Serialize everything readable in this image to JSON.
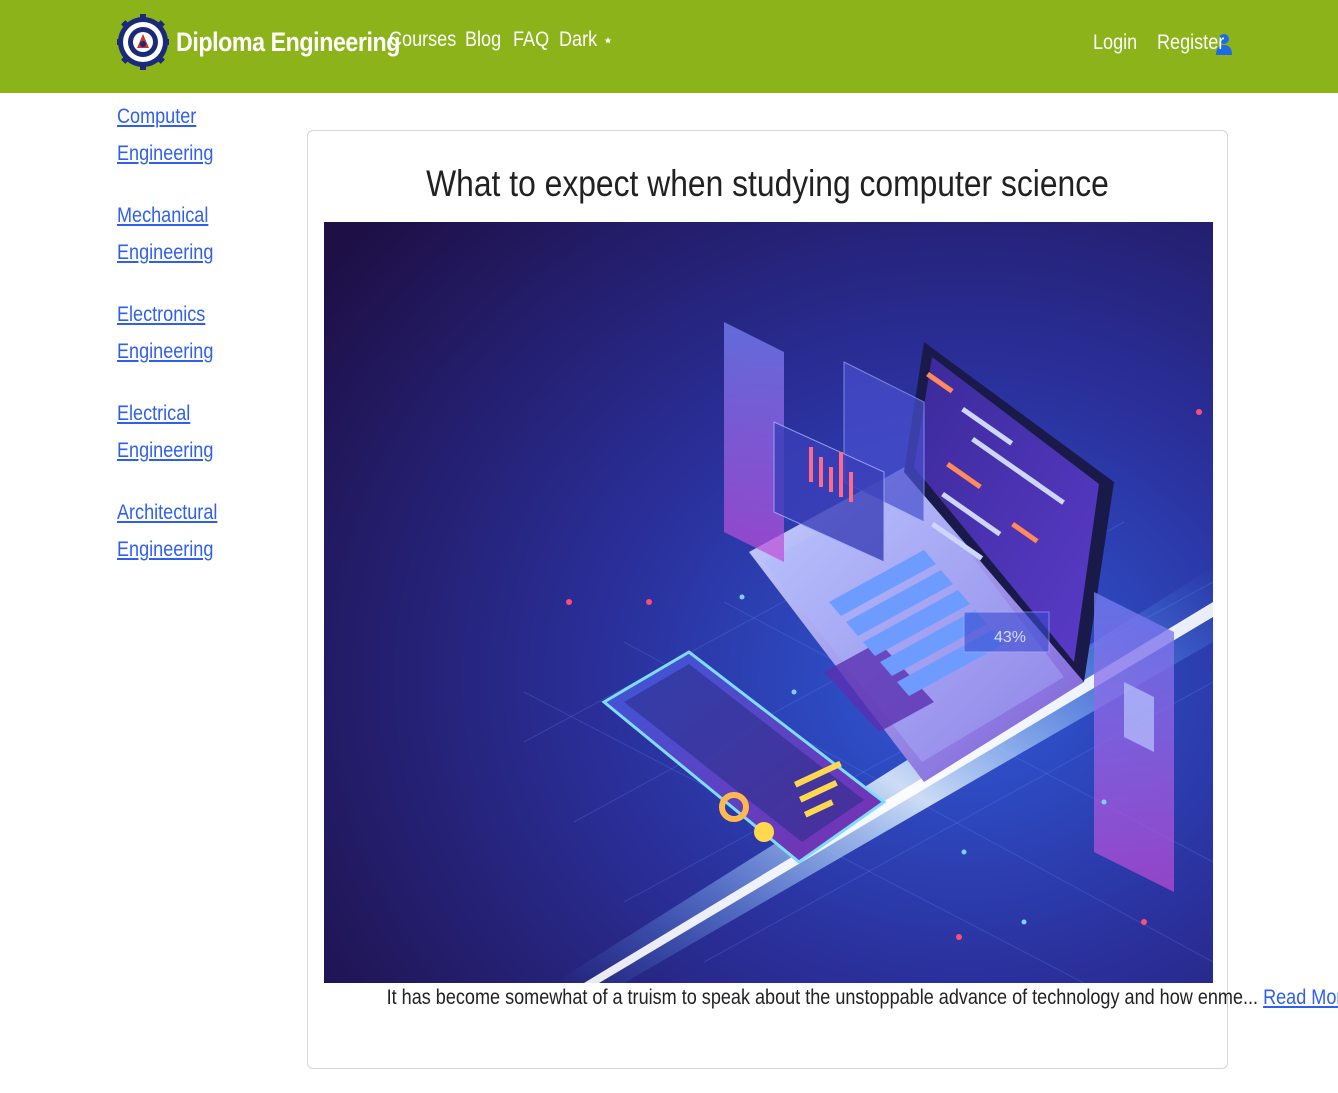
{
  "navbar": {
    "brand": "Diploma Engineering",
    "links": [
      "Courses",
      "Blog",
      "FAQ"
    ],
    "dark_label": "Dark",
    "dark_icon": "moon-star-icon",
    "login": "Login",
    "register": "Register",
    "register_icon": "user-icon",
    "logo_icon": "gear-seal-logo",
    "bg_color": "#8db31b"
  },
  "sidebar": {
    "items": [
      {
        "label": "Computer Engineering"
      },
      {
        "label": "Mechanical Engineering"
      },
      {
        "label": "Electronics Engineering"
      },
      {
        "label": "Electrical Engineering"
      },
      {
        "label": "Architectural Engineering"
      }
    ]
  },
  "article": {
    "title": "What to expect when studying computer science",
    "excerpt": "It has become somewhat of a truism to speak about the unstoppable advance of technology and how enme...",
    "read_more": "Read More",
    "hero_percent": "43%"
  },
  "colors": {
    "link": "#2f5ff0",
    "navbar": "#8db31b"
  }
}
